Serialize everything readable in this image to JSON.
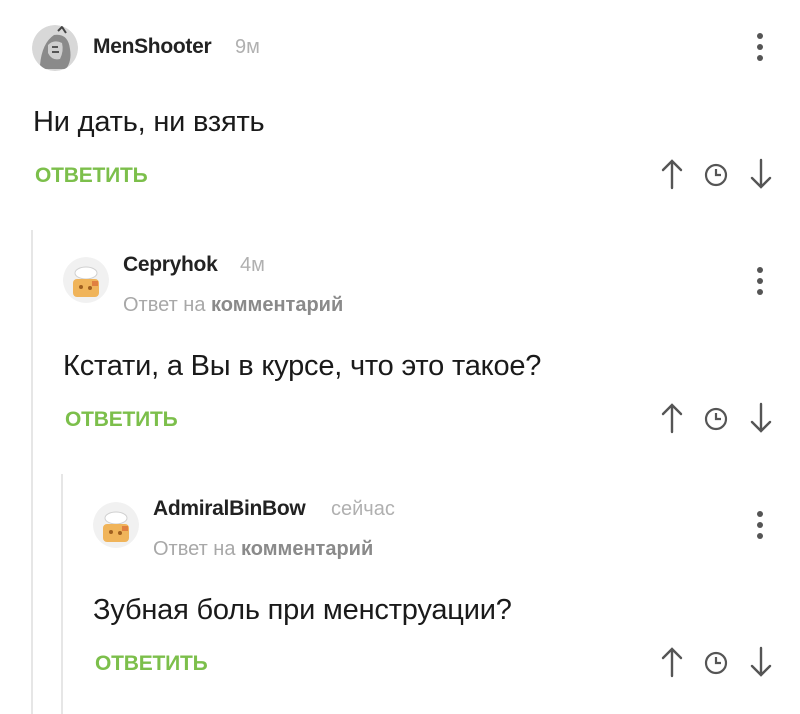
{
  "comments": [
    {
      "username": "MenShooter",
      "time": "9м",
      "text": "Ни дать, ни взять",
      "reply_label": "ОТВЕТИТЬ"
    },
    {
      "username": "Серryhok",
      "time": "4м",
      "reply_to_prefix": "Ответ на",
      "reply_to_link": "комментарий",
      "text": "Кстати, а Вы в курсе, что это такое?",
      "reply_label": "ОТВЕТИТЬ"
    },
    {
      "username": "AdmiralBinBow",
      "time": "сейчас",
      "reply_to_prefix": "Ответ на",
      "reply_to_link": "комментарий",
      "text": "Зубная боль при менструации?",
      "reply_label": "ОТВЕТИТЬ"
    }
  ],
  "icons": {
    "menu": "more-vertical-icon",
    "upvote": "arrow-up-icon",
    "save": "clock-icon",
    "downvote": "arrow-down-icon"
  },
  "colors": {
    "accent_green": "#7cbf4b",
    "thread_line": "#e6e6e6",
    "muted_text": "#b0b0b0"
  }
}
